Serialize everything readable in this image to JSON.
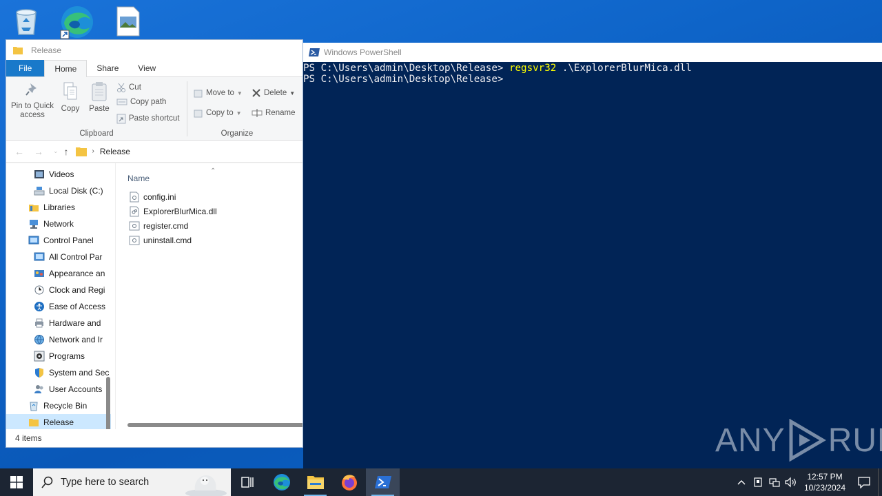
{
  "explorer": {
    "title": "Release",
    "tabs": {
      "file": "File",
      "home": "Home",
      "share": "Share",
      "view": "View"
    },
    "ribbon": {
      "pin": "Pin to Quick access",
      "copy": "Copy",
      "paste": "Paste",
      "cut": "Cut",
      "copy_path": "Copy path",
      "paste_shortcut": "Paste shortcut",
      "clipboard_group": "Clipboard",
      "move_to": "Move to",
      "copy_to": "Copy to",
      "delete": "Delete",
      "rename": "Rename",
      "organize_group": "Organize"
    },
    "address": {
      "crumb": "Release"
    },
    "nav_items": [
      "Videos",
      "Local Disk (C:)",
      "Libraries",
      "Network",
      "Control Panel",
      "All Control Par",
      "Appearance an",
      "Clock and Regi",
      "Ease of Access",
      "Hardware and",
      "Network and Ir",
      "Programs",
      "System and Sec",
      "User Accounts",
      "Recycle Bin",
      "Release"
    ],
    "column_header": "Name",
    "files": [
      "config.ini",
      "ExplorerBlurMica.dll",
      "register.cmd",
      "uninstall.cmd"
    ],
    "status": "4 items"
  },
  "powershell": {
    "title": "Windows PowerShell",
    "line1_prompt": "PS C:\\Users\\admin\\Desktop\\Release> ",
    "line1_cmd": "regsvr32",
    "line1_arg": " .\\ExplorerBlurMica.dll",
    "line2_prompt": "PS C:\\Users\\admin\\Desktop\\Release>"
  },
  "watermark": {
    "left": "ANY",
    "right": "RUN"
  },
  "taskbar": {
    "search_placeholder": "Type here to search",
    "time": "12:57 PM",
    "date": "10/23/2024"
  }
}
